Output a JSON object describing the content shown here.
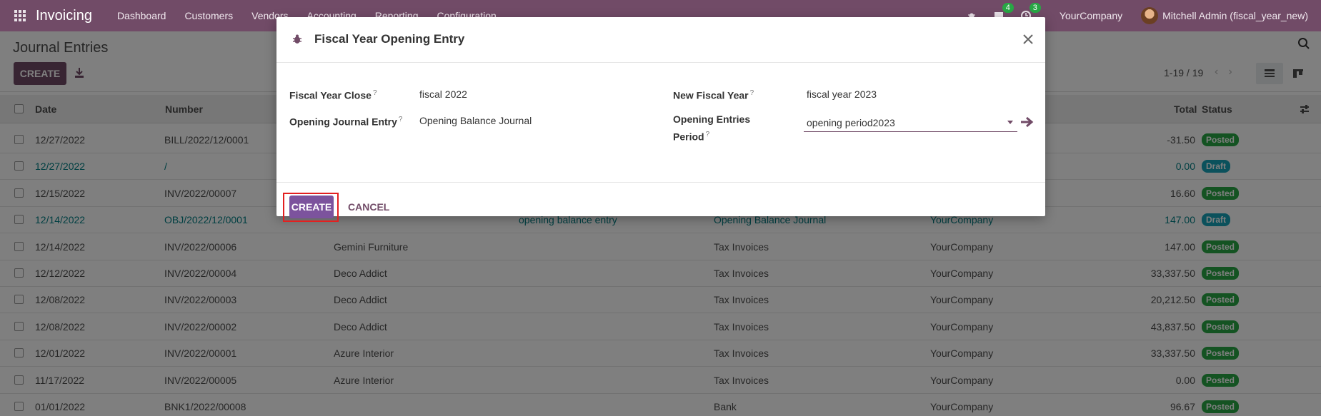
{
  "navbar": {
    "brand": "Invoicing",
    "menu": [
      "Dashboard",
      "Customers",
      "Vendors",
      "Accounting",
      "Reporting",
      "Configuration"
    ],
    "messages_count": "4",
    "activities_count": "3",
    "company": "YourCompany",
    "user": "Mitchell Admin (fiscal_year_new)"
  },
  "control": {
    "title": "Journal Entries",
    "create_label": "CREATE",
    "pager": "1-19 / 19"
  },
  "table": {
    "headers": {
      "date": "Date",
      "number": "Number",
      "total": "Total",
      "status": "Status"
    },
    "rows": [
      {
        "date": "12/27/2022",
        "number": "BILL/2022/12/0001",
        "partner": "",
        "ref": "",
        "journal": "",
        "company": "",
        "total": "-31.50",
        "status": "Posted",
        "draft": false
      },
      {
        "date": "12/27/2022",
        "number": "/",
        "partner": "",
        "ref": "",
        "journal": "",
        "company": "",
        "total": "0.00",
        "status": "Draft",
        "draft": true
      },
      {
        "date": "12/15/2022",
        "number": "INV/2022/00007",
        "partner": "",
        "ref": "",
        "journal": "",
        "company": "",
        "total": "16.60",
        "status": "Posted",
        "draft": false
      },
      {
        "date": "12/14/2022",
        "number": "OBJ/2022/12/0001",
        "partner": "",
        "ref": "opening balance entry",
        "journal": "Opening Balance Journal",
        "company": "YourCompany",
        "total": "147.00",
        "status": "Draft",
        "draft": true
      },
      {
        "date": "12/14/2022",
        "number": "INV/2022/00006",
        "partner": "Gemini Furniture",
        "ref": "",
        "journal": "Tax Invoices",
        "company": "YourCompany",
        "total": "147.00",
        "status": "Posted",
        "draft": false
      },
      {
        "date": "12/12/2022",
        "number": "INV/2022/00004",
        "partner": "Deco Addict",
        "ref": "",
        "journal": "Tax Invoices",
        "company": "YourCompany",
        "total": "33,337.50",
        "status": "Posted",
        "draft": false
      },
      {
        "date": "12/08/2022",
        "number": "INV/2022/00003",
        "partner": "Deco Addict",
        "ref": "",
        "journal": "Tax Invoices",
        "company": "YourCompany",
        "total": "20,212.50",
        "status": "Posted",
        "draft": false
      },
      {
        "date": "12/08/2022",
        "number": "INV/2022/00002",
        "partner": "Deco Addict",
        "ref": "",
        "journal": "Tax Invoices",
        "company": "YourCompany",
        "total": "43,837.50",
        "status": "Posted",
        "draft": false
      },
      {
        "date": "12/01/2022",
        "number": "INV/2022/00001",
        "partner": "Azure Interior",
        "ref": "",
        "journal": "Tax Invoices",
        "company": "YourCompany",
        "total": "33,337.50",
        "status": "Posted",
        "draft": false
      },
      {
        "date": "11/17/2022",
        "number": "INV/2022/00005",
        "partner": "Azure Interior",
        "ref": "",
        "journal": "Tax Invoices",
        "company": "YourCompany",
        "total": "0.00",
        "status": "Posted",
        "draft": false
      },
      {
        "date": "01/01/2022",
        "number": "BNK1/2022/00008",
        "partner": "",
        "ref": "",
        "journal": "Bank",
        "company": "YourCompany",
        "total": "96.67",
        "status": "Posted",
        "draft": false
      }
    ]
  },
  "modal": {
    "title": "Fiscal Year Opening Entry",
    "fiscal_year_close_label": "Fiscal Year Close",
    "fiscal_year_close_value": "fiscal 2022",
    "new_fiscal_year_label": "New Fiscal Year",
    "new_fiscal_year_value": "fiscal year 2023",
    "opening_journal_label": "Opening Journal Entry",
    "opening_journal_value": "Opening Balance Journal",
    "opening_period_label_line1": "Opening Entries",
    "opening_period_label_line2": "Period",
    "opening_period_value": "opening period2023",
    "help_marker": "?",
    "create_label": "CREATE",
    "cancel_label": "CANCEL"
  },
  "colors": {
    "brand": "#714b67",
    "primary_button": "#7c539d",
    "posted": "#28a745",
    "draft": "#17a2b8",
    "highlight": "#e32020"
  }
}
